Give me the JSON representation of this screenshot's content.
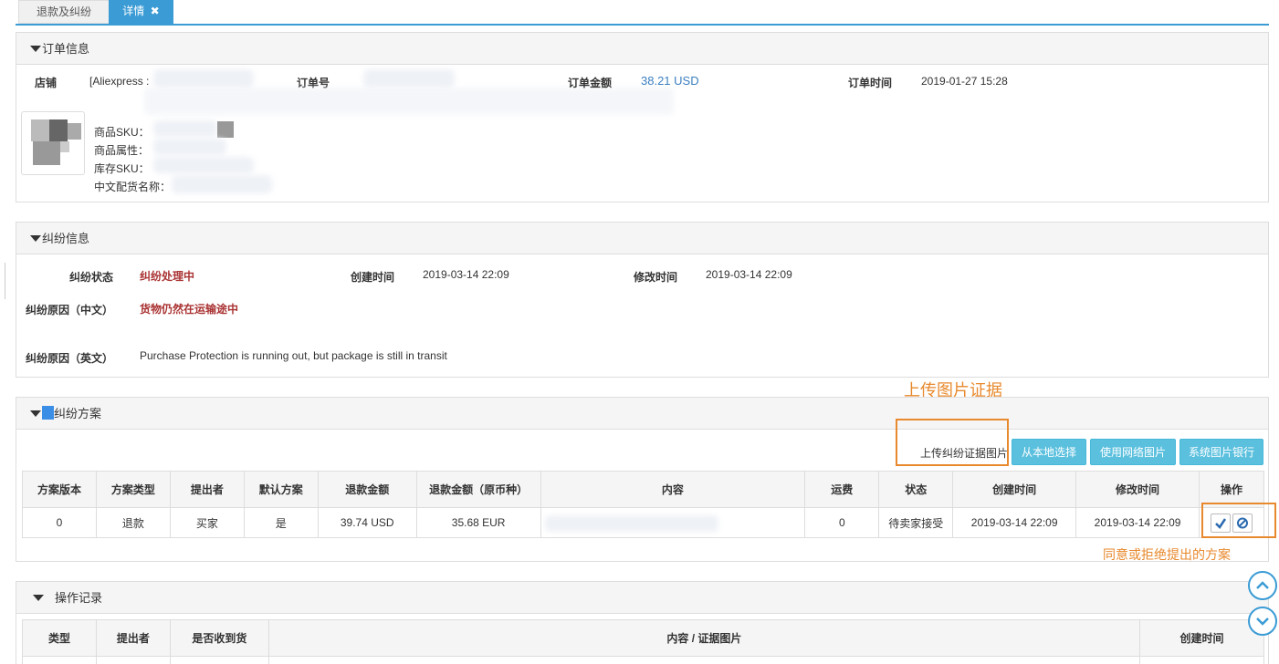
{
  "tabs": [
    {
      "label": "退款及纠纷"
    },
    {
      "label": "详情",
      "close": "✖"
    }
  ],
  "order": {
    "title": "订单信息",
    "shop_label": "店铺",
    "shop_value": "[Aliexpress :",
    "order_no_label": "订单号",
    "amount_label": "订单金额",
    "amount_value": "38.21 USD",
    "time_label": "订单时间",
    "time_value": "2019-01-27 15:28",
    "sku_label": "商品SKU：",
    "attr_label": "商品属性：",
    "stock_sku_label": "库存SKU：",
    "cn_name_label": "中文配货名称："
  },
  "dispute": {
    "title": "纠纷信息",
    "status_label": "纠纷状态",
    "status_value": "纠纷处理中",
    "created_label": "创建时间",
    "created_value": "2019-03-14 22:09",
    "modified_label": "修改时间",
    "modified_value": "2019-03-14 22:09",
    "reason_cn_label": "纠纷原因（中文）",
    "reason_cn_value": "货物仍然在运输途中",
    "reason_en_label": "纠纷原因（英文）",
    "reason_en_value": "Purchase Protection is running out, but package is still in transit"
  },
  "plan": {
    "title": "纠纷方案",
    "upload_label": "上传纠纷证据图片",
    "buttons": {
      "local": "从本地选择",
      "web": "使用网络图片",
      "bank": "系统图片银行"
    },
    "columns": [
      "方案版本",
      "方案类型",
      "提出者",
      "默认方案",
      "退款金额",
      "退款金额（原币种）",
      "内容",
      "运费",
      "状态",
      "创建时间",
      "修改时间",
      "操作"
    ],
    "rows": [
      {
        "version": "0",
        "type": "退款",
        "proposer": "买家",
        "default": "是",
        "refund": "39.74 USD",
        "refund_orig": "35.68 EUR",
        "content": "",
        "shipping": "0",
        "status": "待卖家接受",
        "created": "2019-03-14 22:09",
        "modified": "2019-03-14 22:09"
      }
    ]
  },
  "log": {
    "title": "操作记录",
    "columns": [
      "类型",
      "提出者",
      "是否收到货",
      "内容 / 证据图片",
      "创建时间"
    ]
  },
  "annotations": {
    "upload_hint": "上传图片证据",
    "action_hint": "同意或拒绝提出的方案"
  },
  "colors": {
    "accent": "#3a9bd5",
    "annotation": "#e8892d",
    "button": "#5bc0de",
    "status_red": "#a33333"
  }
}
